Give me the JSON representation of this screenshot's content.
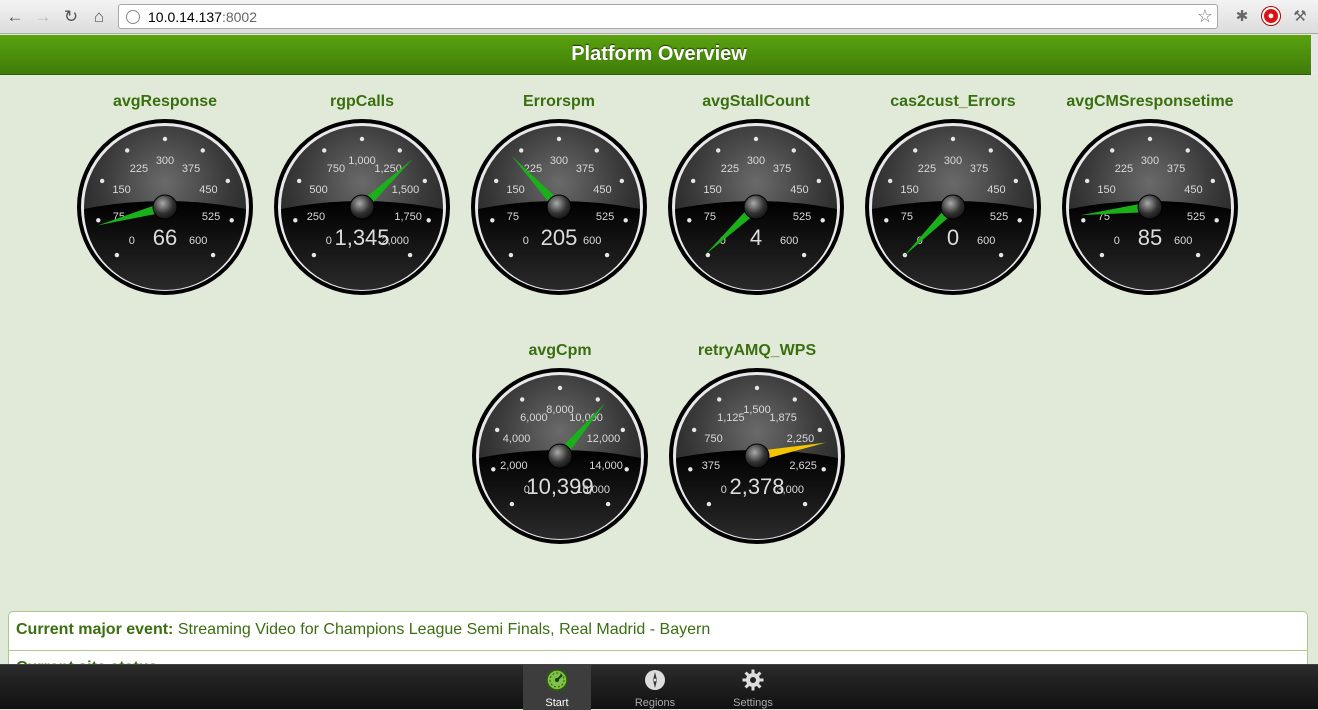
{
  "browser": {
    "url_host": "10.0.14.137",
    "url_port": ":8002"
  },
  "header": {
    "title": "Platform Overview"
  },
  "gauges": [
    {
      "title": "avgResponse",
      "ticks": [
        "0",
        "75",
        "150",
        "225",
        "300",
        "375",
        "450",
        "525",
        "600"
      ],
      "value": 66,
      "display": "66",
      "min": 0,
      "max": 600,
      "needle_color": "#1ab01a"
    },
    {
      "title": "rgpCalls",
      "ticks": [
        "0",
        "250",
        "500",
        "750",
        "1,000",
        "1,250",
        "1,500",
        "1,750",
        "2,000"
      ],
      "value": 1345,
      "display": "1,345",
      "min": 0,
      "max": 2000,
      "needle_color": "#1ab01a"
    },
    {
      "title": "Errorspm",
      "ticks": [
        "0",
        "75",
        "150",
        "225",
        "300",
        "375",
        "450",
        "525",
        "600"
      ],
      "value": 205,
      "display": "205",
      "min": 0,
      "max": 600,
      "needle_color": "#1ab01a"
    },
    {
      "title": "avgStallCount",
      "ticks": [
        "0",
        "75",
        "150",
        "225",
        "300",
        "375",
        "450",
        "525",
        "600"
      ],
      "value": 4,
      "display": "4",
      "min": 0,
      "max": 600,
      "needle_color": "#1ab01a"
    },
    {
      "title": "cas2cust_Errors",
      "ticks": [
        "0",
        "75",
        "150",
        "225",
        "300",
        "375",
        "450",
        "525",
        "600"
      ],
      "value": 0,
      "display": "0",
      "min": 0,
      "max": 600,
      "needle_color": "#1ab01a"
    },
    {
      "title": "avgCMSresponsetime",
      "ticks": [
        "0",
        "75",
        "150",
        "225",
        "300",
        "375",
        "450",
        "525",
        "600"
      ],
      "value": 85,
      "display": "85",
      "min": 0,
      "max": 600,
      "needle_color": "#1ab01a"
    },
    {
      "title": "avgCpm",
      "ticks": [
        "0",
        "2,000",
        "4,000",
        "6,000",
        "8,000",
        "10,000",
        "12,000",
        "14,000",
        "16,000"
      ],
      "value": 10399,
      "display": "10,399",
      "min": 0,
      "max": 16000,
      "needle_color": "#1ab01a"
    },
    {
      "title": "retryAMQ_WPS",
      "ticks": [
        "0",
        "375",
        "750",
        "1,125",
        "1,500",
        "1,875",
        "2,250",
        "2,625",
        "3,000"
      ],
      "value": 2378,
      "display": "2,378",
      "min": 0,
      "max": 3000,
      "needle_color": "#f5c400"
    }
  ],
  "info": {
    "event_label": "Current major event:",
    "event_text": "Streaming Video for Champions League Semi Finals, Real Madrid - Bayern",
    "second_row_partial": "Current site status"
  },
  "tabs": [
    {
      "label": "Start",
      "icon": "speedometer-icon",
      "active": true
    },
    {
      "label": "Regions",
      "icon": "compass-icon",
      "active": false
    },
    {
      "label": "Settings",
      "icon": "gear-icon",
      "active": false
    }
  ]
}
